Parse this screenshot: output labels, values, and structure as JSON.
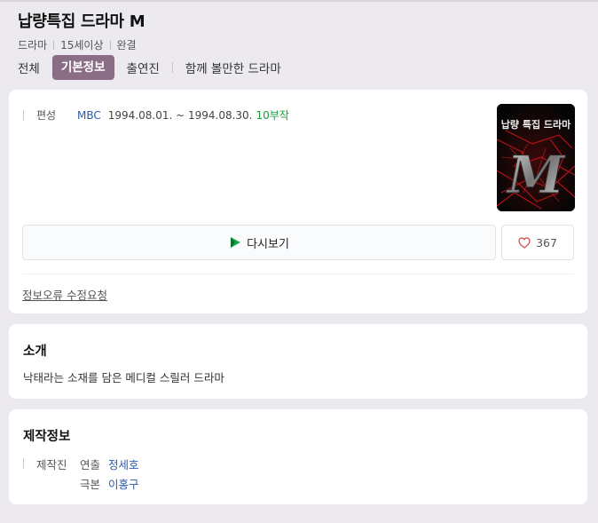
{
  "header": {
    "title": "납량특집 드라마 M",
    "meta": [
      "드라마",
      "15세이상",
      "완결"
    ]
  },
  "tabs": [
    {
      "label": "전체",
      "active": false
    },
    {
      "label": "기본정보",
      "active": true
    },
    {
      "label": "출연진",
      "active": false
    },
    {
      "label": "함께 볼만한 드라마",
      "active": false
    }
  ],
  "info": {
    "label": "편성",
    "channel": "MBC",
    "dates": "1994.08.01. ~ 1994.08.30.",
    "episodes": "10부작"
  },
  "poster": {
    "text": "납량 특집 드라마",
    "letter": "M"
  },
  "actions": {
    "watch_label": "다시보기",
    "like_count": "367",
    "report_label": "정보오류 수정요청"
  },
  "intro": {
    "title": "소개",
    "text": "낙태라는 소재를 담은 메디컬 스릴러 드라마"
  },
  "production": {
    "title": "제작정보",
    "label": "제작진",
    "rows": [
      {
        "role": "연출",
        "name": "정세호"
      },
      {
        "role": "극본",
        "name": "이홍구"
      }
    ]
  },
  "colors": {
    "tab_active": "#8a6e86",
    "link": "#2a5aa8",
    "episodes": "#1a9a3a",
    "background": "#edeaef"
  },
  "icons": [
    "play-icon",
    "heart-icon"
  ]
}
